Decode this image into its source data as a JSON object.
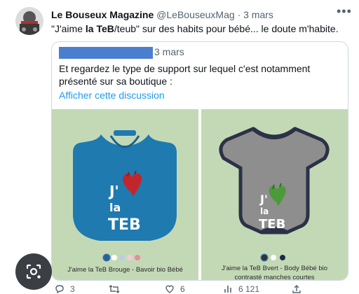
{
  "tweet": {
    "author_name": "Le Bouseux Magazine",
    "handle": "@LeBouseuxMag",
    "separator": "·",
    "time": "3 mars",
    "text_before": "\"J'aime ",
    "text_bold": "la TeB",
    "text_after": "/teub\" sur des habits pour bébé... le doute m'habite."
  },
  "quote": {
    "time": "3 mars",
    "text": "Et regardez le type de support sur lequel c'est notamment présenté sur sa boutique :",
    "link": "Afficher cette discussion",
    "products": [
      {
        "print_line1": "J'",
        "print_line2": "la",
        "print_line3": "TEB",
        "caption": "J'aime la TeB Brouge - Bavoir bio Bébé",
        "swatch_colors": [
          "#2c5f9a",
          "#ffffff",
          "#b9cde6",
          "#f6c9d6",
          "#e88a9b"
        ]
      },
      {
        "print_line1": "J'",
        "print_line2": "la",
        "print_line3": "TEB",
        "caption_line1": "J'aime la TeB Bvert - Body Bébé bio",
        "caption_line2": "contrasté manches courtes",
        "swatch_colors": [
          "#333333",
          "#ffffff",
          "#1e2a4a"
        ]
      }
    ]
  },
  "actions": {
    "reply_count": "3",
    "retweet_count": "",
    "like_count": "6",
    "views_count": "6 121"
  },
  "colors": {
    "link": "#1d9bf0",
    "bib": "#1f7ab0",
    "body_grey": "#8e8e8e",
    "body_trim": "#2b3247",
    "panel_bg": "#c3d9b6"
  },
  "icons": [
    "avatar-image",
    "more-icon",
    "lens-icon",
    "reply-icon",
    "retweet-icon",
    "like-icon",
    "views-icon",
    "share-icon"
  ]
}
